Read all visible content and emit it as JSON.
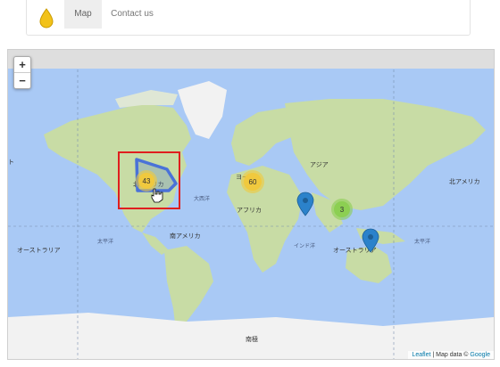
{
  "nav": {
    "logo_icon": "water-drop-icon",
    "tabs": [
      {
        "label": "Map",
        "active": true
      },
      {
        "label": "Contact us",
        "active": false
      }
    ]
  },
  "map": {
    "zoom_in": "+",
    "zoom_out": "−",
    "labels": {
      "north_america": "北アメリカ",
      "greenland": "",
      "europe": "ヨーロ",
      "asia": "アジア",
      "africa": "アフリカ",
      "south_america": "南アメリカ",
      "australia_east": "オーストラリア",
      "australia_west": "オーストラリア",
      "atlantic": "大西洋",
      "pacific_west": "太平洋",
      "pacific_east": "太平洋",
      "indian_ocean": "インド洋",
      "antarctica": "南極",
      "north_america_east": "北アメリカ",
      "left_edge": "ト"
    },
    "clusters": [
      {
        "id": "north-america",
        "count": "43",
        "color": "#f0c93e"
      },
      {
        "id": "europe",
        "count": "60",
        "color": "#f0c93e"
      },
      {
        "id": "asia",
        "count": "3",
        "color": "#8ccf52"
      }
    ],
    "markers": [
      "india-marker",
      "australia-marker"
    ],
    "attribution": {
      "leaflet": "Leaflet",
      "sep": " | Map data © ",
      "google": "Google"
    },
    "colors": {
      "ocean": "#a9c9f5",
      "land": "#c8dca5",
      "ice": "#f2f2f2",
      "highlight_box": "#e01e1e",
      "polygon": "#4a72d8",
      "marker": "#2b82cb"
    }
  }
}
